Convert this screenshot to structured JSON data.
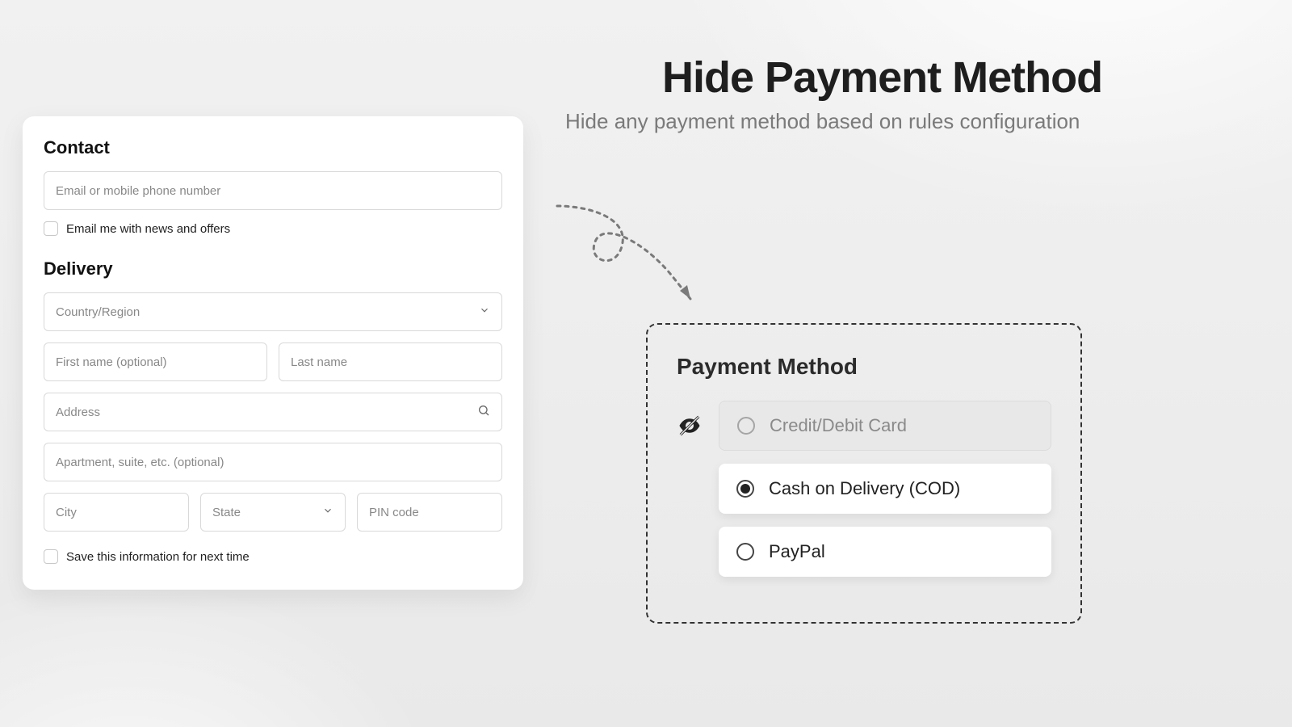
{
  "hero": {
    "title": "Hide Payment Method",
    "subtitle": "Hide any payment method based on rules configuration"
  },
  "checkout": {
    "contact_title": "Contact",
    "email_placeholder": "Email or mobile phone number",
    "news_label": "Email me with news and offers",
    "delivery_title": "Delivery",
    "country_placeholder": "Country/Region",
    "firstname_placeholder": "First name (optional)",
    "lastname_placeholder": "Last name",
    "address_placeholder": "Address",
    "apt_placeholder": "Apartment, suite, etc. (optional)",
    "city_placeholder": "City",
    "state_placeholder": "State",
    "pin_placeholder": "PIN code",
    "save_label": "Save this information for next time"
  },
  "payment": {
    "title": "Payment Method",
    "methods": {
      "credit": "Credit/Debit Card",
      "cod": "Cash on Delivery (COD)",
      "paypal": "PayPal"
    }
  }
}
